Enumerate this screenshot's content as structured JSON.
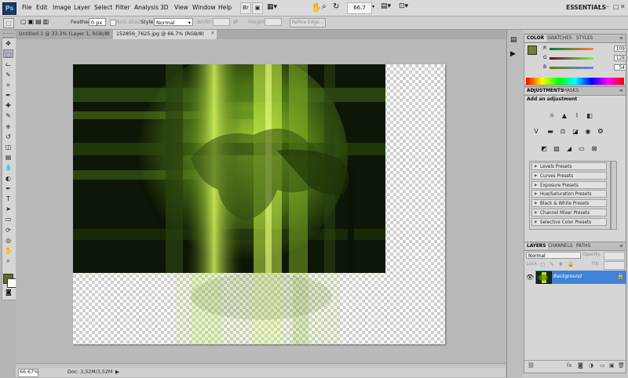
{
  "app": {
    "logo": "Ps",
    "workspace": "ESSENTIALS"
  },
  "menu": [
    "File",
    "Edit",
    "Image",
    "Layer",
    "Select",
    "Filter",
    "Analysis",
    "3D",
    "View",
    "Window",
    "Help"
  ],
  "menubar": {
    "zoom_value": "66.7"
  },
  "options": {
    "feather_label": "Feather:",
    "feather_value": "0 px",
    "antialias_label": "Anti-alias",
    "style_label": "Style:",
    "style_value": "Normal",
    "width_label": "Width:",
    "height_label": "Height:",
    "refine_edge": "Refine Edge..."
  },
  "tabs": [
    {
      "label": "Untitled-1 @ 33.3% (Layer 1, RGB/8)"
    },
    {
      "label": "152856_7625.jpg @ 66.7% (RGB/8)"
    }
  ],
  "status": {
    "zoom": "66.67%",
    "doc": "Doc: 3,52M/3,52M"
  },
  "color_panel": {
    "tabs": [
      "COLOR",
      "SWATCHES",
      "STYLES"
    ],
    "channels": [
      {
        "label": "R",
        "value": "109"
      },
      {
        "label": "G",
        "value": "128"
      },
      {
        "label": "B",
        "value": "54"
      }
    ],
    "foreground": "#6d8036"
  },
  "adjust_panel": {
    "tabs": [
      "ADJUSTMENTS",
      "MASKS"
    ],
    "heading": "Add an adjustment",
    "presets": [
      "Levels Presets",
      "Curves Presets",
      "Exposure Presets",
      "Hue/Saturation Presets",
      "Black & White Presets",
      "Channel Mixer Presets",
      "Selective Color Presets"
    ]
  },
  "layers_panel": {
    "tabs": [
      "LAYERS",
      "CHANNELS",
      "PATHS"
    ],
    "blend_mode": "Normal",
    "opacity_label": "Opacity:",
    "lock_label": "Lock:",
    "fill_label": "Fill:",
    "layer_name": "Background"
  },
  "icons": {
    "tools": [
      "move-icon",
      "marquee-icon",
      "lasso-icon",
      "quick-select-icon",
      "crop-icon",
      "eyedropper-icon",
      "healing-icon",
      "brush-icon",
      "stamp-icon",
      "history-brush-icon",
      "eraser-icon",
      "gradient-icon",
      "blur-icon",
      "dodge-icon",
      "pen-icon",
      "type-icon",
      "path-select-icon",
      "shape-icon",
      "3d-rotate-icon",
      "3d-orbit-icon",
      "hand-icon",
      "zoom-icon"
    ]
  }
}
